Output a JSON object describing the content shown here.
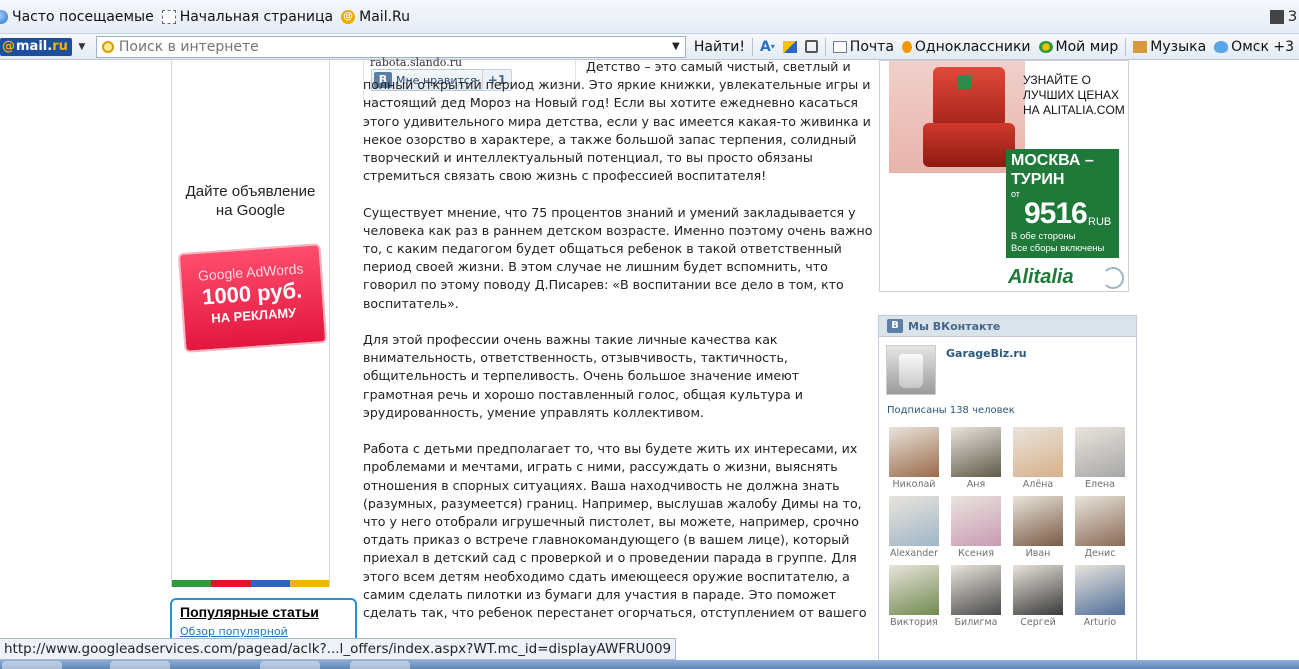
{
  "browser": {
    "bookmarks": [
      "Часто посещаемые",
      "Начальная страница",
      "Mail.Ru"
    ],
    "bookmarks_right": "З",
    "toolbar": {
      "logo": {
        "at": "@",
        "mail": "mail",
        "dot": ".",
        "ru": "ru"
      },
      "search_placeholder": "Поиск в интернете",
      "search_button": "Найти!",
      "text_tool": "A",
      "items": [
        "Почта",
        "Одноклассники",
        "Мой мир",
        "Музыка",
        "Омск +3"
      ]
    },
    "status_url": "http://www.googleadservices.com/pagead/aclk?...l_offers/index.aspx?WT.mc_id=displayAWFRU009"
  },
  "left_ad": {
    "text": "Дайте объявление на Google",
    "badge_line1": "Google AdWords",
    "badge_line2": "1000 руб.",
    "badge_line3": "НА РЕКЛАМУ",
    "stripe_colors": [
      "#2e9a3c",
      "#e2142d",
      "#2f63c8",
      "#f5b400"
    ]
  },
  "popular": {
    "title": "Популярные статьи",
    "link": "Обзор популярной"
  },
  "like_widget": {
    "site": "rabota.slando.ru",
    "button": "Мне нравится",
    "vk_letter": "В",
    "count": "+1"
  },
  "article": {
    "paragraphs": [
      "Детство – это самый чистый, светлый и полный открытий период жизни. Это яркие книжки, увлекательные игры и настоящий дед Мороз на Новый год! Если вы хотите ежедневно касаться этого удивительного мира детства, если у вас имеется какая-то живинка и некое озорство в характере, а также большой запас терпения, солидный творческий и интеллектуальный потенциал, то вы просто обязаны стремиться связать свою жизнь с профессией воспитателя!",
      "Существует мнение, что 75 процентов знаний и умений закладывается у человека как раз в раннем детском возрасте. Именно поэтому очень важно то, с каким педагогом будет общаться ребенок в такой ответственный период своей жизни. В этом случае не лишним будет вспомнить, что говорил по этому поводу Д.Писарев: «В воспитании все дело в том, кто воспитатель».",
      "Для этой профессии очень важны такие личные качества как внимательность, ответственность, отзывчивость, тактичность, общительность и терпеливость. Очень большое значение имеют грамотная речь и хорошо поставленный голос, общая культура и эрудированность, умение управлять коллективом.",
      "Работа с детьми предполагает то, что вы будете жить их интересами, их проблемами и мечтами, играть с ними, рассуждать о жизни, выяснять отношения в спорных ситуациях. Ваша находчивость не должна знать (разумных, разумеется) границ. Например, выслушав жалобу Димы на то, что у него отобрали игрушечный пистолет, вы можете, например, срочно отдать приказ о встрече главнокомандующего (в вашем лице), который приехал в детский сад с проверкой и о проведении парада в группе. Для этого всем детям необходимо сдать имеющееся оружие воспитателю, а самим сделать пилотки из бумаги для участия в параде. Это поможет сделать так, что ребенок перестанет огорчаться, отступлением от вашего"
    ]
  },
  "alitalia_ad": {
    "promo_lines": [
      "УЗНАЙТЕ О",
      "ЛУЧШИХ ЦЕНАХ",
      "НА ALITALIA.COM"
    ],
    "route_line1": "МОСКВА –",
    "route_line2": "ТУРИН",
    "from": "от",
    "price": "9516",
    "currency": "RUB",
    "note1": "В обе стороны",
    "note2": "Все сборы включены",
    "brand": "Alitalia",
    "brand_color": "#1f7a3a"
  },
  "vk_group": {
    "header": "Мы ВКонтакте",
    "vk_letter": "В",
    "group_name": "GarageBiz.ru",
    "subscribers": "Подписаны 138 человек",
    "members": [
      {
        "name": "Николай",
        "color": "#9a6a4a"
      },
      {
        "name": "Аня",
        "color": "#5f5a4a"
      },
      {
        "name": "Алёна",
        "color": "#d8b08a"
      },
      {
        "name": "Елена",
        "color": "#a8a8a8"
      },
      {
        "name": "Alexander",
        "color": "#9fb6c8"
      },
      {
        "name": "Ксения",
        "color": "#c99ab4"
      },
      {
        "name": "Иван",
        "color": "#7a5a45"
      },
      {
        "name": "Денис",
        "color": "#8a6a56"
      },
      {
        "name": "Виктория",
        "color": "#6f8a4f"
      },
      {
        "name": "Билигма",
        "color": "#4a4a4a"
      },
      {
        "name": "Сергей",
        "color": "#3a3a3a"
      },
      {
        "name": "Arturio",
        "color": "#4f6f9a"
      }
    ]
  }
}
